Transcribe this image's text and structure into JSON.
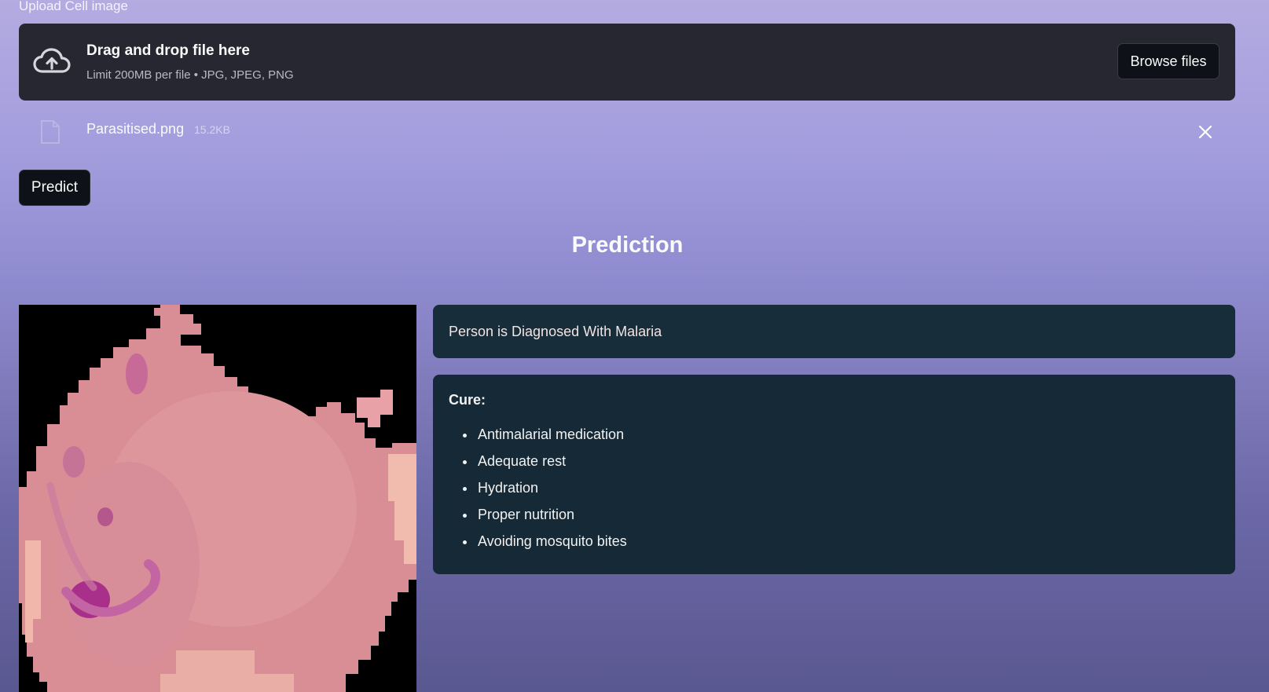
{
  "uploader": {
    "label": "Upload Cell image",
    "drop_title": "Drag and drop file here",
    "drop_limit": "Limit 200MB per file • JPG, JPEG, PNG",
    "browse_label": "Browse files"
  },
  "file": {
    "name": "Parasitised.png",
    "size": "15.2KB"
  },
  "predict_label": "Predict",
  "prediction": {
    "heading": "Prediction",
    "result": "Person is Diagnosed With Malaria",
    "cure_title": "Cure:",
    "cures": [
      "Antimalarial medication",
      "Adequate rest",
      "Hydration",
      "Proper nutrition",
      "Avoiding mosquito bites"
    ]
  },
  "icons": {
    "upload": "cloud-upload-icon",
    "file": "file-icon",
    "remove": "close-icon"
  },
  "colors": {
    "dropzone_bg": "#262730",
    "button_bg": "#0e1117",
    "result_bg": "#172d3a"
  }
}
